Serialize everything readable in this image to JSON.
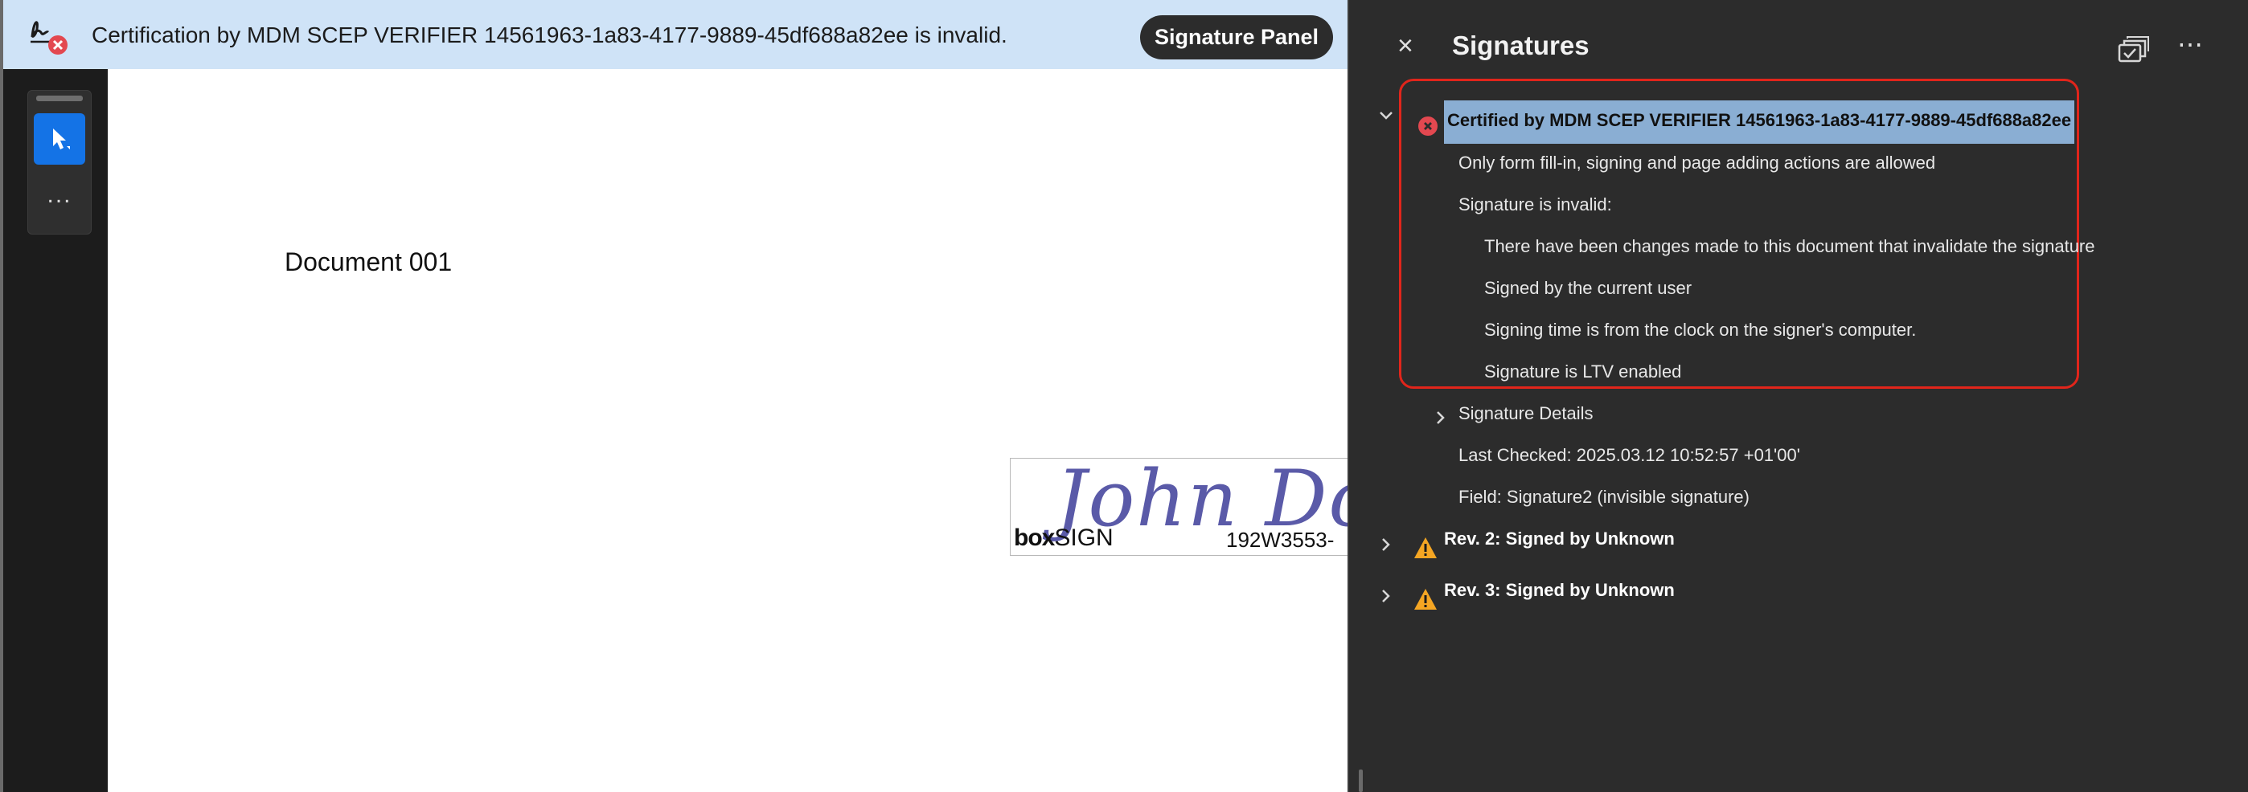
{
  "notification": {
    "icon": "signature-invalid-icon",
    "message": "Certification by MDM SCEP VERIFIER 14561963-1a83-4177-9889-45df688a82ee is invalid.",
    "button_label": "Signature Panel"
  },
  "tools": {
    "select_icon": "arrow-cursor-icon",
    "more_label": "..."
  },
  "document": {
    "title": "Document 001",
    "signature": {
      "script_text": "John Do",
      "brand_bold": "box",
      "brand_text": "SIGN",
      "code": "192W3553-"
    }
  },
  "panel": {
    "close_label": "×",
    "title": "Signatures",
    "more_label": "⋯",
    "certified": {
      "title": "Certified by MDM SCEP VERIFIER 14561963-1a83-4177-9889-45df688a82ee",
      "permission": "Only form fill-in, signing and page adding actions are allowed",
      "status": "Signature is invalid:",
      "details": [
        "There have been changes made to this document that invalidate the signature",
        "Signed by the current user",
        "Signing time is from the clock on the signer's computer.",
        "Signature is LTV enabled"
      ],
      "signature_details_label": "Signature Details",
      "last_checked": "Last Checked: 2025.03.12 10:52:57 +01'00'",
      "field": "Field: Signature2 (invisible signature)"
    },
    "revisions": [
      {
        "label": "Rev. 2: Signed by Unknown"
      },
      {
        "label": "Rev. 3: Signed by Unknown"
      }
    ]
  },
  "colors": {
    "accent": "#1473e6",
    "error": "#e34850",
    "warning": "#f5a623",
    "highlight_border": "#e1251b",
    "selection": "#8aaed3"
  }
}
